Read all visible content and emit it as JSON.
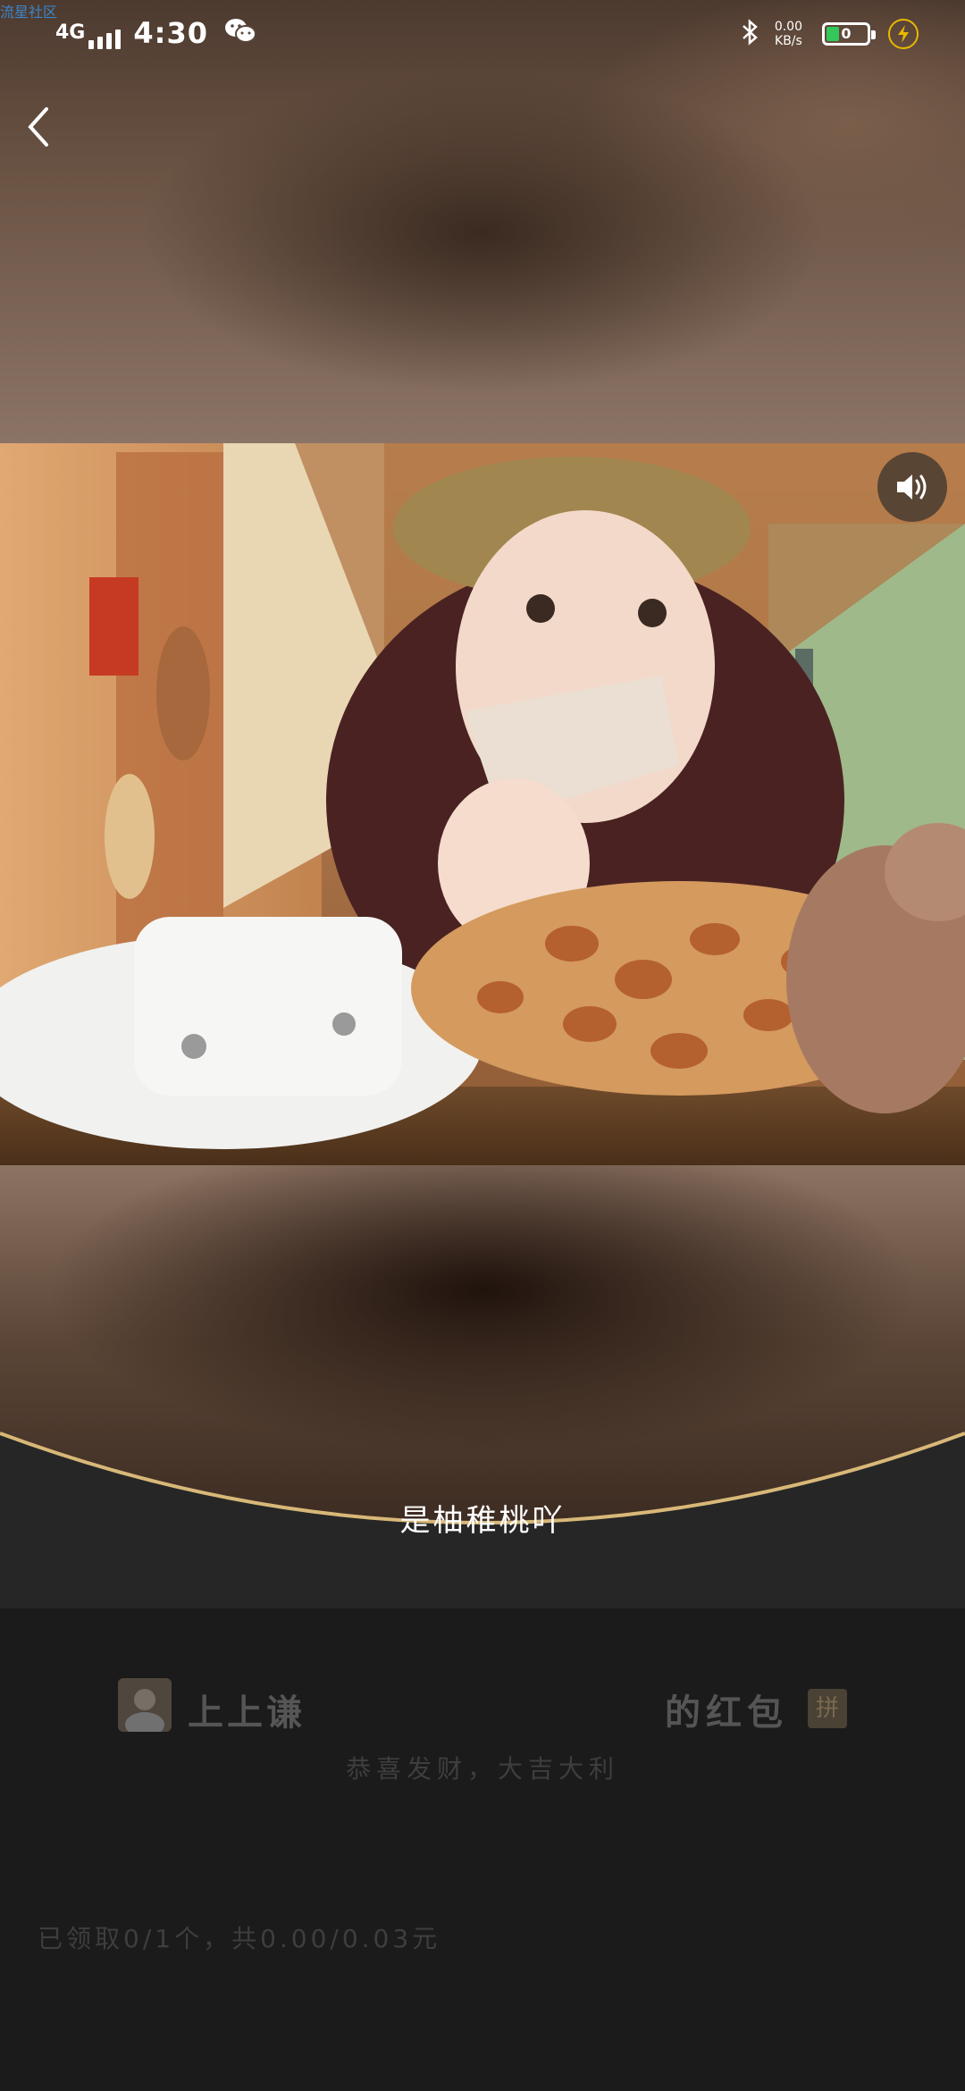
{
  "watermark": "流星社区",
  "status_bar": {
    "network": "4G",
    "time": "4:30",
    "speed_value": "0.00",
    "speed_unit": "KB/s",
    "battery": "0",
    "icons": [
      "signal-icon",
      "wechat-icon",
      "bluetooth-icon",
      "battery-icon",
      "charging-icon"
    ]
  },
  "nav": {
    "back_icon": "chevron-left-icon"
  },
  "media": {
    "sound_icon": "volume-icon"
  },
  "caption": "是柚稚桃吖",
  "red_packet": {
    "sender_name": "上上谦",
    "title_suffix": "的红包",
    "badge": "拼",
    "wish": "恭喜发财，大吉大利",
    "received_summary": "已领取0/1个，共0.00/0.03元"
  },
  "colors": {
    "panel_bg": "#1b1b1b",
    "gold_curve": "#d8b878",
    "battery_fill": "#34c759"
  }
}
